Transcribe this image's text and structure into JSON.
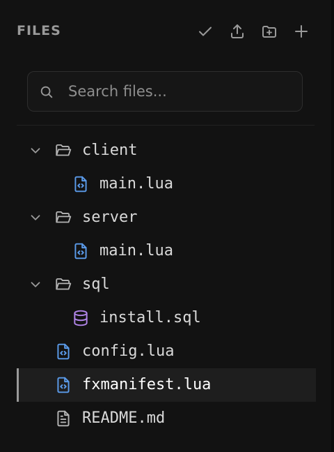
{
  "header": {
    "title": "FILES",
    "actions": [
      {
        "name": "confirm",
        "icon": "check-icon"
      },
      {
        "name": "upload",
        "icon": "upload-icon"
      },
      {
        "name": "new-folder",
        "icon": "folder-plus-icon"
      },
      {
        "name": "new-file",
        "icon": "plus-icon"
      }
    ]
  },
  "search": {
    "placeholder": "Search files...",
    "value": ""
  },
  "tree": {
    "items": [
      {
        "type": "folder",
        "label": "client",
        "expanded": true,
        "icon": "folder-open-icon"
      },
      {
        "type": "file",
        "label": "main.lua",
        "icon": "code-file-icon"
      },
      {
        "type": "folder",
        "label": "server",
        "expanded": true,
        "icon": "folder-open-icon"
      },
      {
        "type": "file",
        "label": "main.lua",
        "icon": "code-file-icon"
      },
      {
        "type": "folder",
        "label": "sql",
        "expanded": true,
        "icon": "folder-open-icon"
      },
      {
        "type": "file",
        "label": "install.sql",
        "icon": "database-icon"
      },
      {
        "type": "file",
        "label": "config.lua",
        "icon": "code-file-icon"
      },
      {
        "type": "file",
        "label": "fxmanifest.lua",
        "icon": "code-file-icon",
        "selected": true
      },
      {
        "type": "file",
        "label": "README.md",
        "icon": "text-file-icon"
      }
    ]
  },
  "colors": {
    "background": "#121212",
    "code_icon": "#5b9bea",
    "database_icon": "#b185e8",
    "muted_icon": "#9a9a9a",
    "selected_row": "#1e1e1e"
  }
}
